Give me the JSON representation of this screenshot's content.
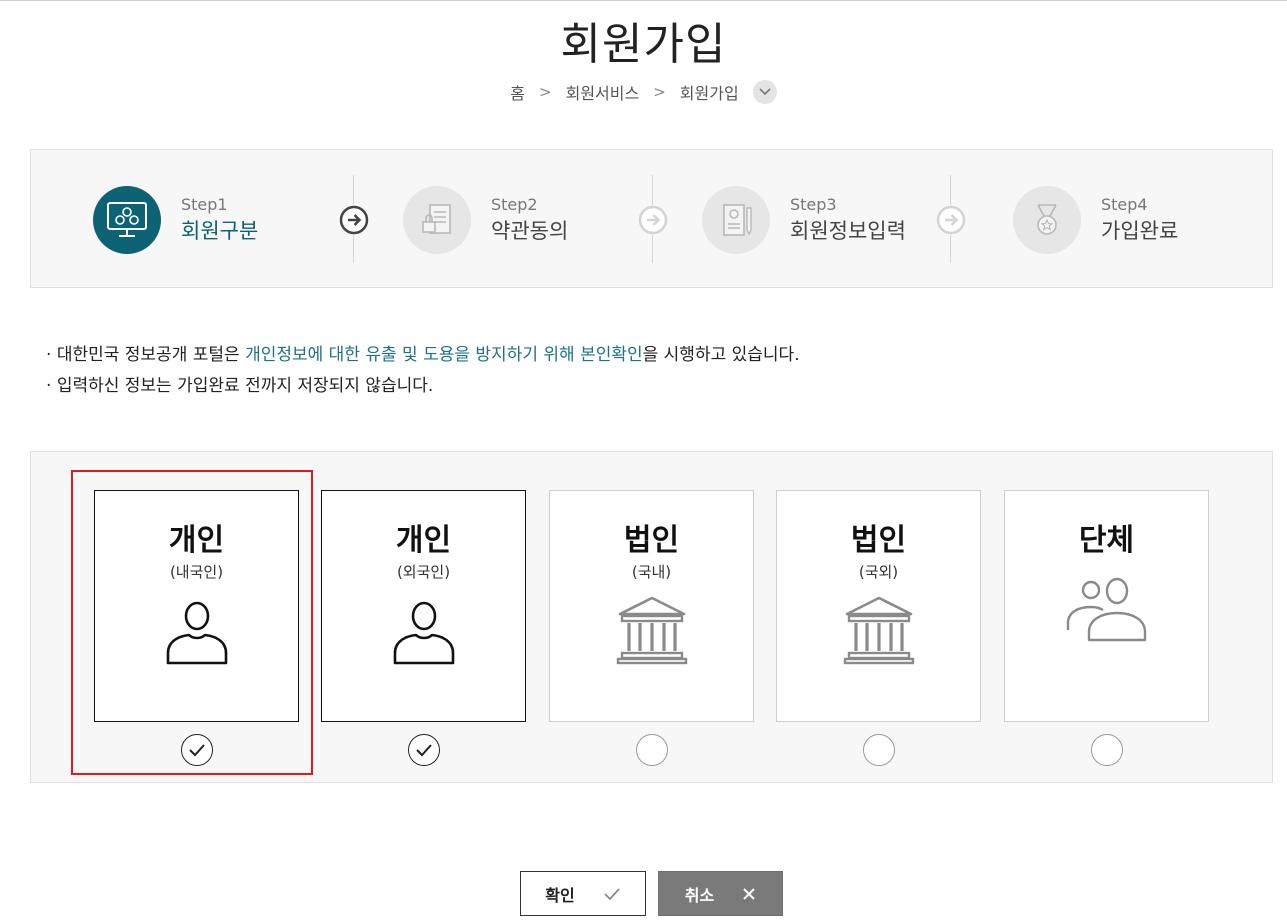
{
  "page": {
    "title": "회원가입"
  },
  "breadcrumb": {
    "items": [
      "홈",
      "회원서비스",
      "회원가입"
    ]
  },
  "steps": [
    {
      "num": "Step1",
      "name": "회원구분",
      "icon": "members-monitor-icon",
      "active": true
    },
    {
      "num": "Step2",
      "name": "약관동의",
      "icon": "document-lock-icon",
      "active": false
    },
    {
      "num": "Step3",
      "name": "회원정보입력",
      "icon": "profile-form-icon",
      "active": false
    },
    {
      "num": "Step4",
      "name": "가입완료",
      "icon": "medal-icon",
      "active": false
    }
  ],
  "notices": [
    {
      "pre": "대한민국 정보공개 포털은 ",
      "highlight": "개인정보에 대한 유출 및 도용을 방지하기 위해 본인확인",
      "post": "을 시행하고 있습니다."
    },
    {
      "pre": "입력하신 정보는 가입완료 전까지 저장되지 않습니다.",
      "highlight": "",
      "post": ""
    }
  ],
  "member_types": [
    {
      "title": "개인",
      "sub": "(내국인)",
      "icon": "person-icon",
      "checked": true
    },
    {
      "title": "개인",
      "sub": "(외국인)",
      "icon": "person-icon",
      "checked": true
    },
    {
      "title": "법인",
      "sub": "(국내)",
      "icon": "bank-building-icon",
      "checked": false
    },
    {
      "title": "법인",
      "sub": "(국외)",
      "icon": "bank-building-icon",
      "checked": false
    },
    {
      "title": "단체",
      "sub": "",
      "icon": "group-icon",
      "checked": false
    }
  ],
  "buttons": {
    "confirm": "확인",
    "cancel": "취소"
  },
  "colors": {
    "accent": "#0d6274",
    "highlight_text": "#1e7186",
    "selection_box": "#e01b1b"
  }
}
